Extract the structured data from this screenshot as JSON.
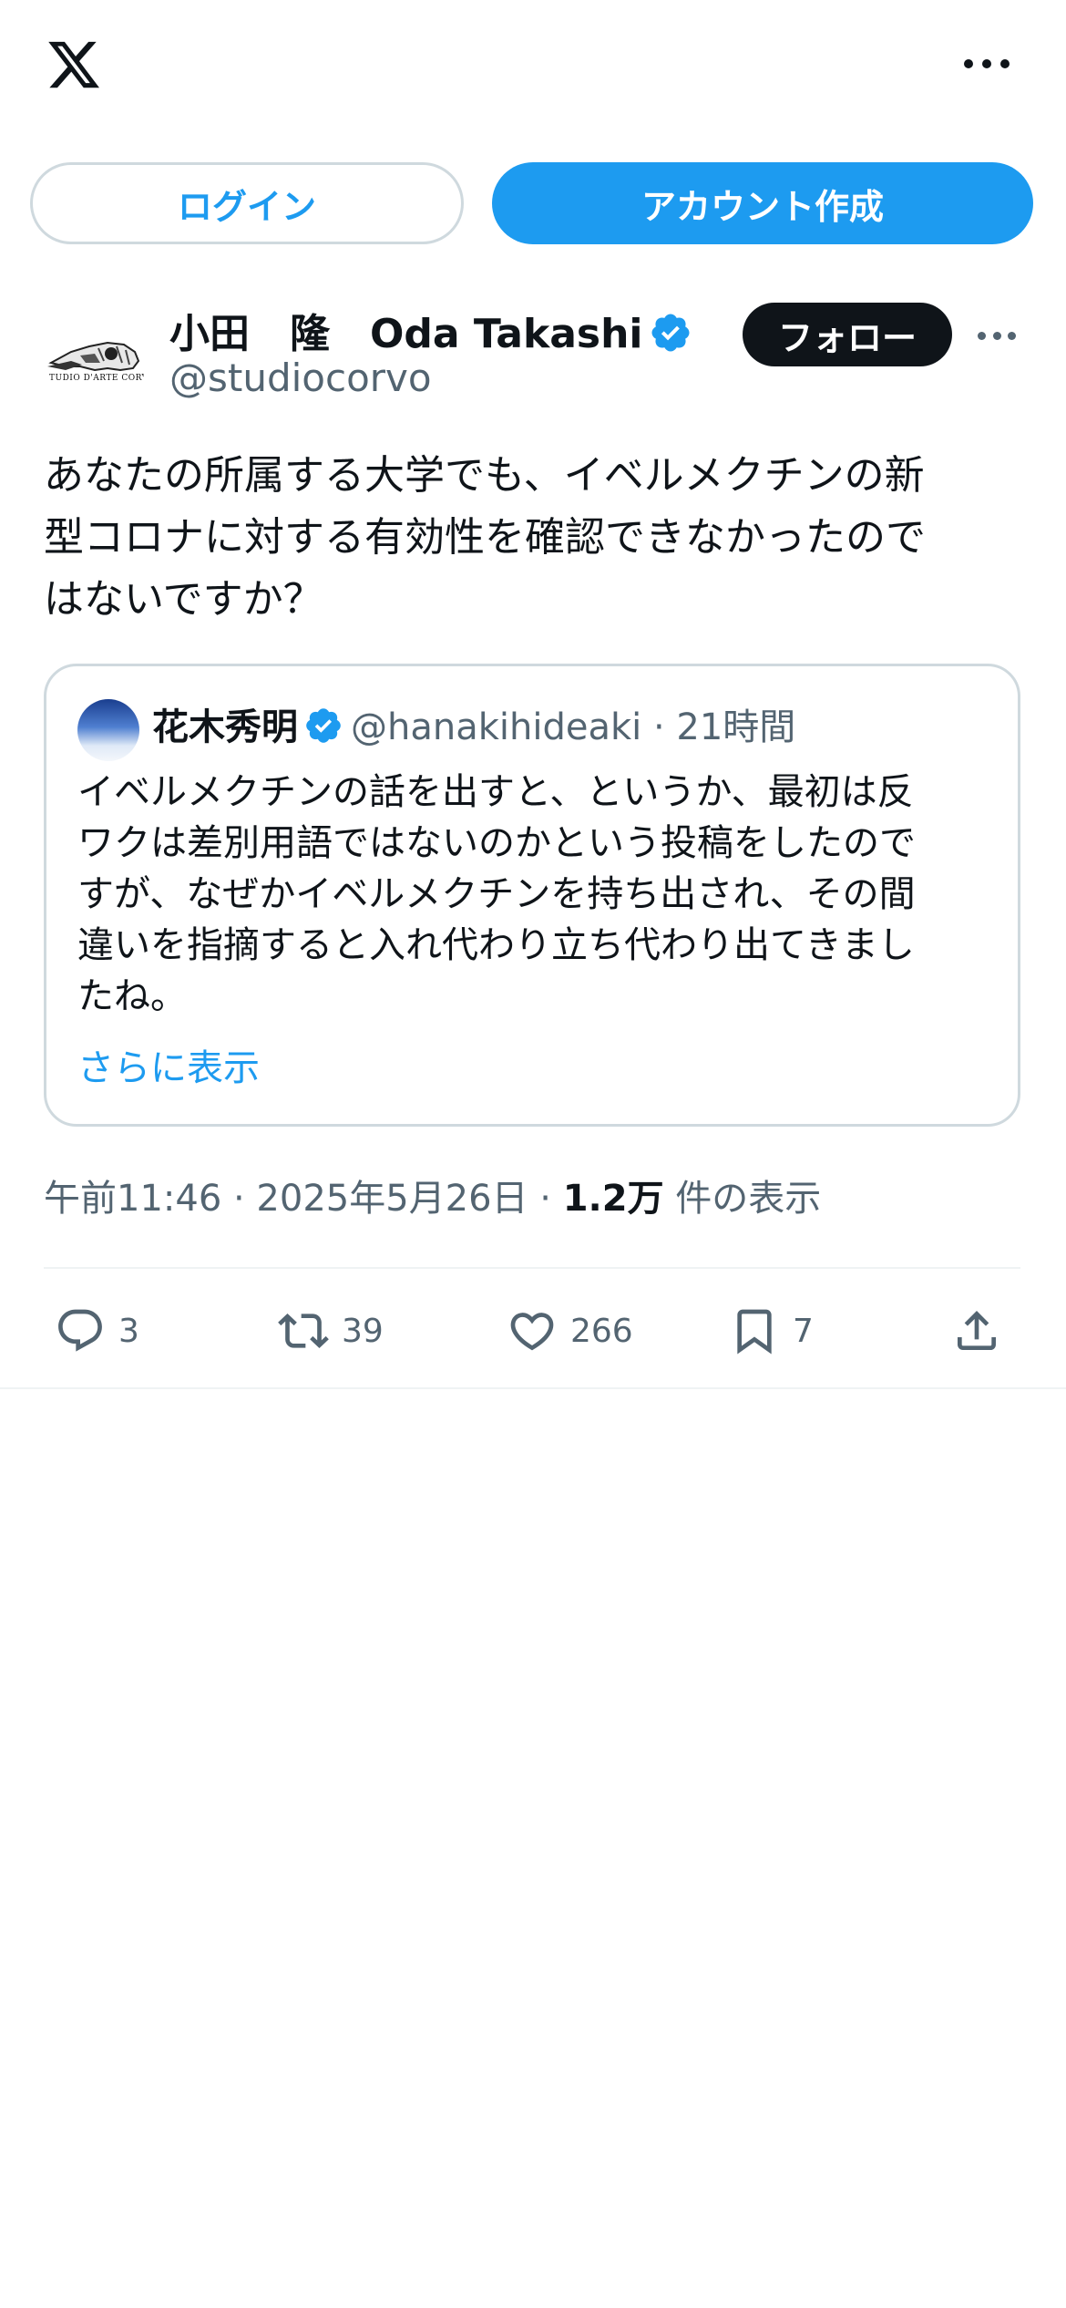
{
  "header": {
    "logo_icon": "x-logo-icon",
    "more_icon": "more-horizontal-icon"
  },
  "auth": {
    "login_label": "ログイン",
    "signup_label": "アカウント作成"
  },
  "tweet": {
    "author_name": "小田　隆　Oda Takashi",
    "author_handle": "@studiocorvo",
    "avatar_caption": "TUDIO D'ARTE CORVO",
    "follow_label": "フォロー",
    "text": "あなたの所属する大学でも、イベルメクチンの新\n型コロナに対する有効性を確認できなかったので\nはないですか？",
    "quote": {
      "author_name": "花木秀明",
      "author_handle": "@hanakihideaki · 21時間",
      "text": "イベルメクチンの話を出すと、というか、最初は反\nワクは差別用語ではないのかという投稿をしたので\nすが、なぜかイベルメクチンを持ち出され、その間\n違いを指摘すると入れ代わり立ち代わり出てきまし\nたね。",
      "show_more": "さらに表示"
    },
    "meta": {
      "timestamp": "午前11:46 · 2025年5月26日 · ",
      "views_count": "1.2万",
      "views_label": " 件の表示"
    },
    "actions": {
      "replies": "3",
      "reposts": "39",
      "likes": "266",
      "bookmarks": "7"
    }
  },
  "colors": {
    "accent": "#1d9bf0",
    "text": "#0f1419",
    "secondary": "#536471",
    "border": "#cfd9de"
  }
}
